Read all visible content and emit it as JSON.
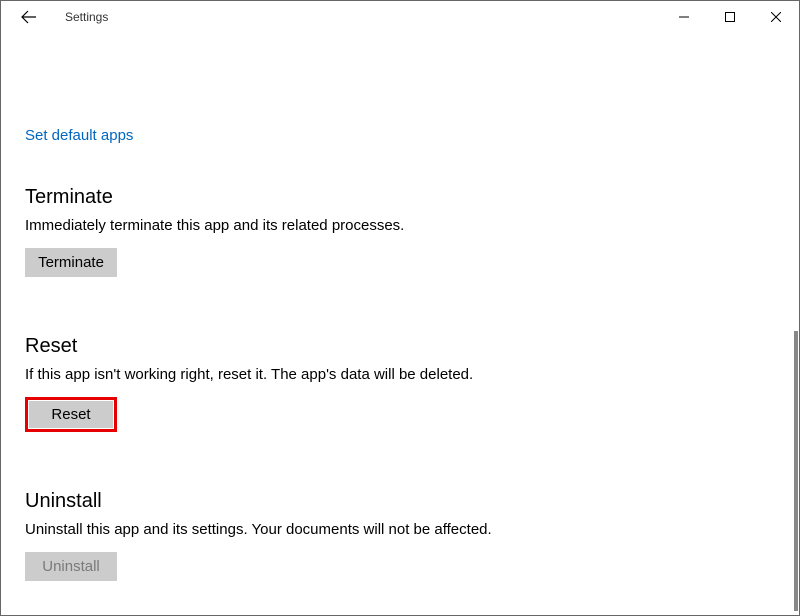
{
  "window": {
    "title": "Settings"
  },
  "link": {
    "set_default_apps": "Set default apps"
  },
  "terminate": {
    "title": "Terminate",
    "desc": "Immediately terminate this app and its related processes.",
    "button": "Terminate"
  },
  "reset": {
    "title": "Reset",
    "desc": "If this app isn't working right, reset it. The app's data will be deleted.",
    "button": "Reset"
  },
  "uninstall": {
    "title": "Uninstall",
    "desc": "Uninstall this app and its settings. Your documents will not be affected.",
    "button": "Uninstall"
  }
}
